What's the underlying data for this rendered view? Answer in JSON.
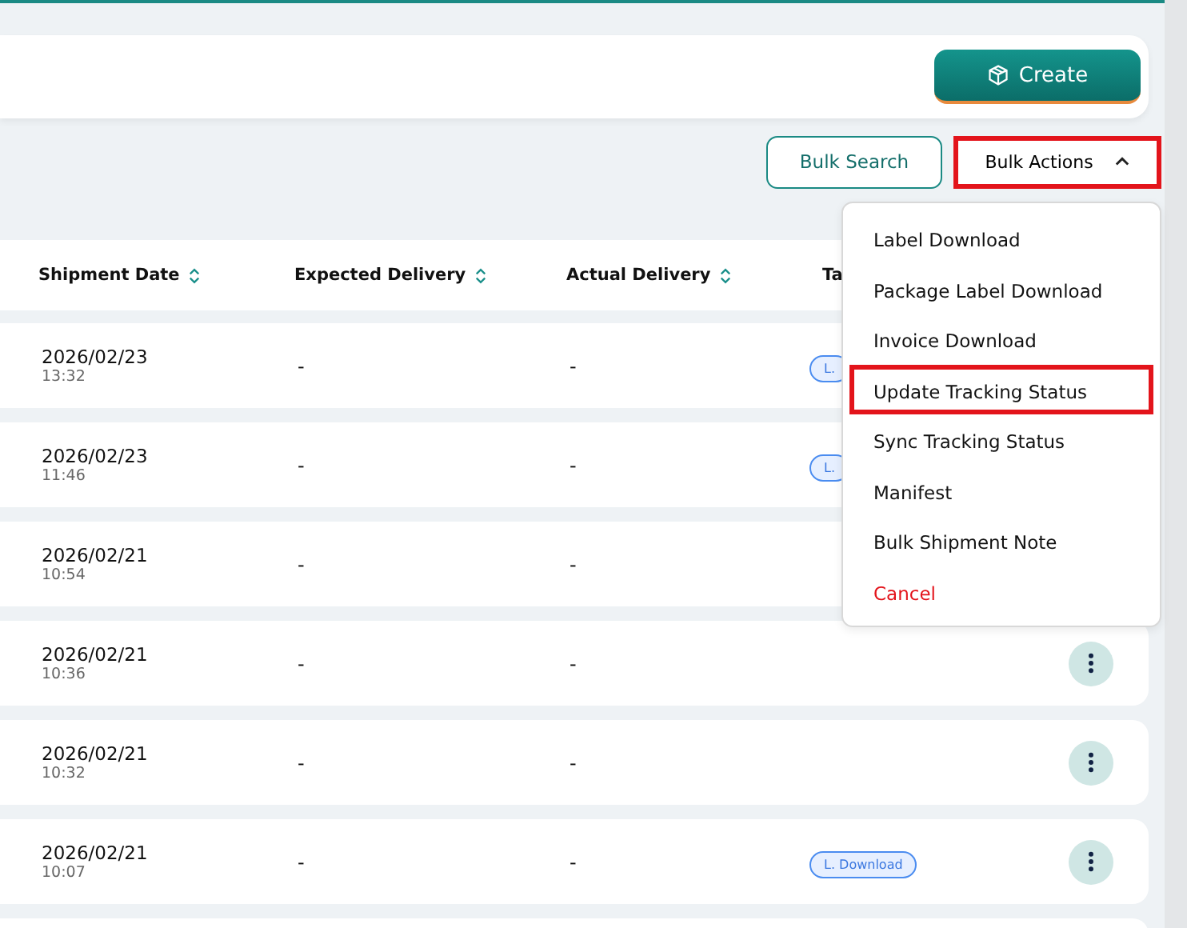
{
  "header": {
    "create_button": "Create"
  },
  "toolbar": {
    "bulk_search": "Bulk Search",
    "bulk_actions": {
      "label": "Bulk Actions",
      "expanded": true,
      "highlighted": true
    }
  },
  "bulk_actions_menu": [
    {
      "label": "Label Download",
      "kind": "normal",
      "highlighted": false
    },
    {
      "label": "Package Label Download",
      "kind": "normal",
      "highlighted": false
    },
    {
      "label": "Invoice Download",
      "kind": "normal",
      "highlighted": false
    },
    {
      "label": "Update Tracking Status",
      "kind": "normal",
      "highlighted": true
    },
    {
      "label": "Sync Tracking Status",
      "kind": "normal",
      "highlighted": false
    },
    {
      "label": "Manifest",
      "kind": "normal",
      "highlighted": false
    },
    {
      "label": "Bulk Shipment Note",
      "kind": "normal",
      "highlighted": false
    },
    {
      "label": "Cancel",
      "kind": "danger",
      "highlighted": false
    }
  ],
  "table": {
    "columns": [
      {
        "label": "Shipment Date",
        "sortable": true
      },
      {
        "label": "Expected Delivery",
        "sortable": true
      },
      {
        "label": "Actual Delivery",
        "sortable": true
      },
      {
        "label": "Ta"
      }
    ],
    "rows": [
      {
        "date": "2026/02/23",
        "time": "13:32",
        "expected": "-",
        "actual": "-",
        "tag": "L."
      },
      {
        "date": "2026/02/23",
        "time": "11:46",
        "expected": "-",
        "actual": "-",
        "tag": "L."
      },
      {
        "date": "2026/02/21",
        "time": "10:54",
        "expected": "-",
        "actual": "-"
      },
      {
        "date": "2026/02/21",
        "time": "10:36",
        "expected": "-",
        "actual": "-",
        "menu_button": true
      },
      {
        "date": "2026/02/21",
        "time": "10:32",
        "expected": "-",
        "actual": "-",
        "menu_button": true
      },
      {
        "date": "2026/02/21",
        "time": "10:07",
        "expected": "-",
        "actual": "-",
        "tag": "L. Download",
        "menu_button": true
      }
    ]
  }
}
